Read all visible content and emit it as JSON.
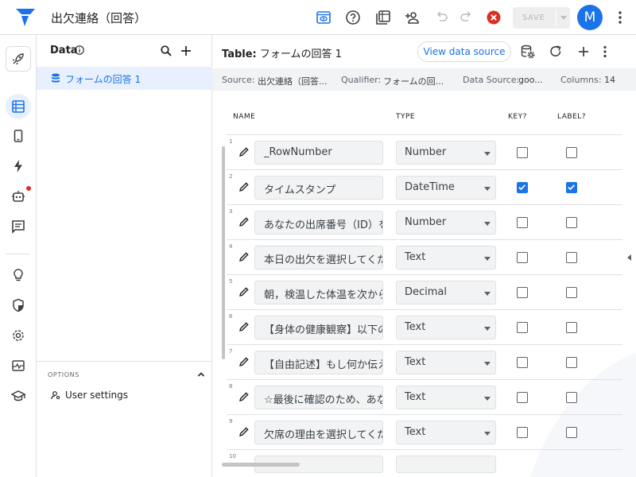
{
  "app": {
    "title": "出欠連絡（回答）",
    "save_label": "SAVE",
    "avatar_letter": "M",
    "accent": "#1a73e8"
  },
  "data_panel": {
    "title": "Data",
    "tables": [
      {
        "label": "フォームの回答 1"
      }
    ],
    "options_title": "OPTIONS",
    "user_settings_label": "User settings"
  },
  "main": {
    "table_title_prefix": "Table:",
    "table_title_name": "フォームの回答 1",
    "view_source_label": "View data source",
    "info": {
      "source_label": "Source:",
      "source_value": "出欠連絡（回答...",
      "qualifier_label": "Qualifier:",
      "qualifier_value": "フォームの回...",
      "data_source_label": "Data Source:",
      "data_source_value": "goo...",
      "columns_label": "Columns:",
      "columns_value": "14"
    },
    "headers": {
      "name": "NAME",
      "type": "TYPE",
      "key": "KEY?",
      "label": "LABEL?"
    },
    "rows": [
      {
        "num": "1",
        "name": "_RowNumber",
        "type": "Number",
        "key": false,
        "label": false
      },
      {
        "num": "2",
        "name": "タイムスタンプ",
        "type": "DateTime",
        "key": true,
        "label": true
      },
      {
        "num": "3",
        "name": "あなたの出席番号（ID）を",
        "type": "Number",
        "key": false,
        "label": false
      },
      {
        "num": "4",
        "name": "本日の出欠を選択してくだ",
        "type": "Text",
        "key": false,
        "label": false
      },
      {
        "num": "5",
        "name": "朝，検温した体温を次から",
        "type": "Decimal",
        "key": false,
        "label": false
      },
      {
        "num": "6",
        "name": "【身体の健康観察】以下の",
        "type": "Text",
        "key": false,
        "label": false
      },
      {
        "num": "7",
        "name": "【自由記述】もし何か伝え",
        "type": "Text",
        "key": false,
        "label": false
      },
      {
        "num": "8",
        "name": "☆最後に確認のため、あな",
        "type": "Text",
        "key": false,
        "label": false
      },
      {
        "num": "9",
        "name": "欠席の理由を選択してくだ",
        "type": "Text",
        "key": false,
        "label": false
      },
      {
        "num": "10",
        "name": "",
        "type": "",
        "key": false,
        "label": false
      }
    ]
  }
}
